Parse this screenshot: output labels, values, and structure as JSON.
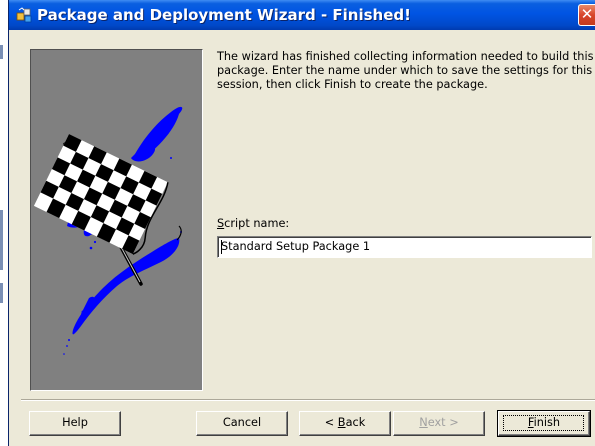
{
  "window": {
    "title": "Package and Deployment Wizard - Finished!",
    "title_icon": "package-wizard-icon",
    "close_glyph": "✕",
    "close_icon": "close-icon"
  },
  "graphic": {
    "name": "checkered-flag-image"
  },
  "description": "The wizard has finished collecting information needed to build this package. Enter the name under which to save the settings for this session, then click Finish to create the package.",
  "script_name": {
    "label_accel": "S",
    "label_rest": "cript name:",
    "value": "Standard Setup Package 1"
  },
  "buttons": {
    "help": {
      "label": "Help"
    },
    "cancel": {
      "label": "Cancel"
    },
    "back": {
      "prefix": "< ",
      "accel": "B",
      "rest": "ack"
    },
    "next": {
      "accel": "N",
      "rest": "ext >",
      "enabled": false
    },
    "finish": {
      "accel": "F",
      "rest": "inish"
    }
  },
  "colors": {
    "titlebar": "#0054e3",
    "dialog_bg": "#ece9d8",
    "graphic_bg": "#808080",
    "flag_blue": "#0000ff",
    "close_red": "#d8452a"
  }
}
